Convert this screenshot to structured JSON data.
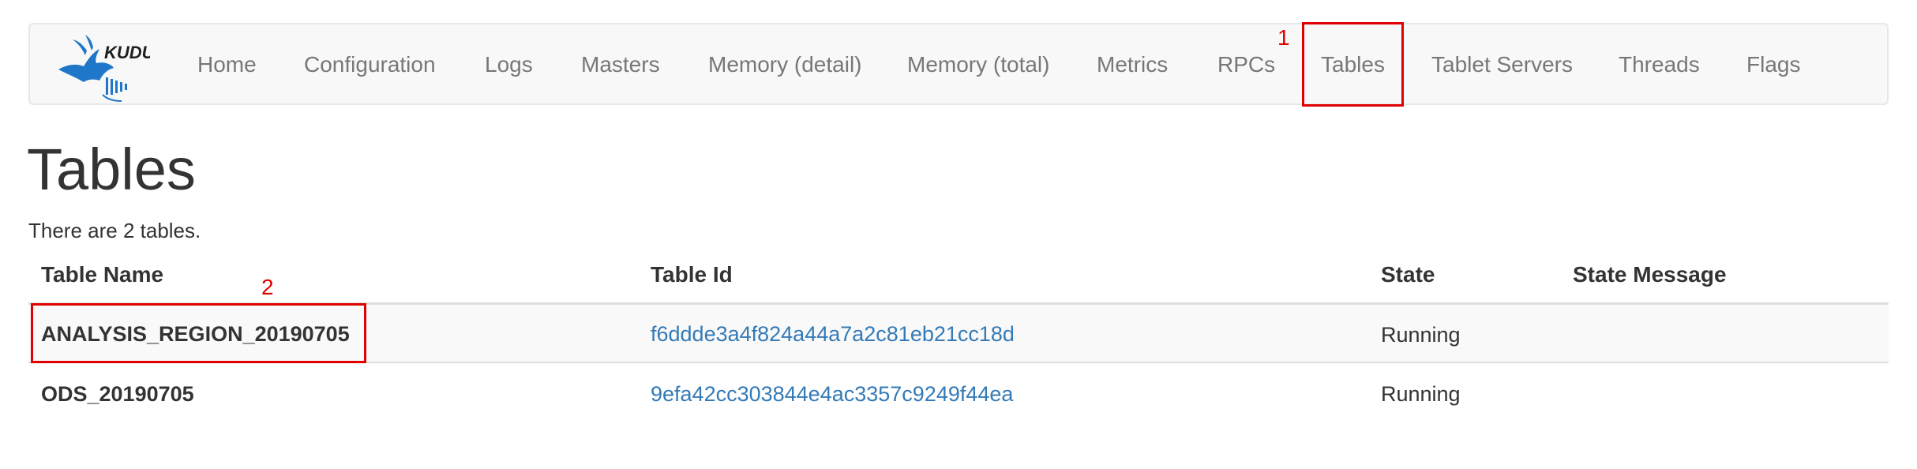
{
  "logo": {
    "text": "KUDU",
    "color": "#1f77c9"
  },
  "nav": {
    "items": [
      {
        "label": "Home"
      },
      {
        "label": "Configuration"
      },
      {
        "label": "Logs"
      },
      {
        "label": "Masters"
      },
      {
        "label": "Memory (detail)"
      },
      {
        "label": "Memory (total)"
      },
      {
        "label": "Metrics"
      },
      {
        "label": "RPCs"
      },
      {
        "label": "Tables",
        "active": true
      },
      {
        "label": "Tablet Servers"
      },
      {
        "label": "Threads"
      },
      {
        "label": "Flags"
      }
    ]
  },
  "annotations": {
    "marker_1": "1",
    "marker_2": "2",
    "color": "#e00000"
  },
  "page": {
    "title": "Tables",
    "summary": "There are 2 tables."
  },
  "table": {
    "headers": [
      "Table Name",
      "Table Id",
      "State",
      "State Message"
    ],
    "rows": [
      {
        "name": "ANALYSIS_REGION_20190705",
        "id": "f6ddde3a4f824a44a7a2c81eb21cc18d",
        "state": "Running",
        "message": ""
      },
      {
        "name": "ODS_20190705",
        "id": "9efa42cc303844e4ac3357c9249f44ea",
        "state": "Running",
        "message": ""
      }
    ]
  },
  "colors": {
    "link": "#337ab7",
    "nav_text": "#777777",
    "navbar_bg": "#f8f8f8"
  }
}
